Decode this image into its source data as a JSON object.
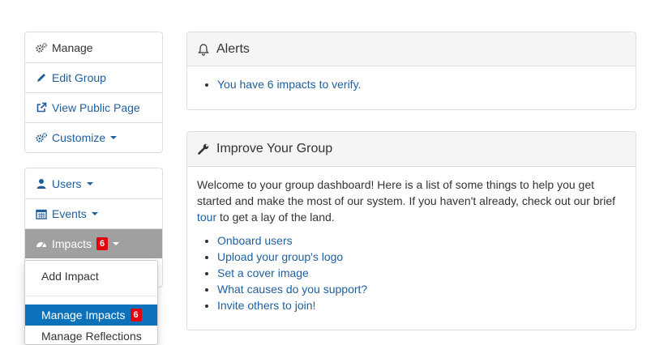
{
  "sidebar": {
    "group1": [
      {
        "label": "Manage",
        "icon": "cogs-icon"
      },
      {
        "label": "Edit Group",
        "icon": "pencil-icon"
      },
      {
        "label": "View Public Page",
        "icon": "external-link-icon"
      },
      {
        "label": "Customize",
        "icon": "cogs-icon"
      }
    ],
    "group2": [
      {
        "label": "Users",
        "icon": "user-icon"
      },
      {
        "label": "Events",
        "icon": "calendar-icon"
      },
      {
        "label": "Impacts",
        "icon": "dashboard-icon",
        "badge": "6"
      }
    ]
  },
  "impacts_dropdown": {
    "items": [
      {
        "label": "Add Impact"
      },
      {
        "label": "Manage Impacts",
        "badge": "6"
      },
      {
        "label": "Manage Reflections"
      }
    ]
  },
  "alerts": {
    "title": "Alerts",
    "icon": "bell-icon",
    "items": [
      "You have 6 impacts to verify."
    ]
  },
  "improve": {
    "title": "Improve Your Group",
    "icon": "wrench-icon",
    "intro": "Welcome to your group dashboard! Here is a list of some things to help you get started and make the most of our system. If you haven't already, check out our brief",
    "tour_link": "tour",
    "intro_end": "to get a lay of the land.",
    "links": [
      "Onboard users",
      "Upload your group's logo",
      "Set a cover image",
      "What causes do you support?",
      "Invite others to join!"
    ]
  },
  "colors": {
    "link": "#1f5f9e",
    "active_item_bg": "#a0a0a0",
    "badge": "#e3000f",
    "dropdown_selected": "#0b72b9"
  }
}
